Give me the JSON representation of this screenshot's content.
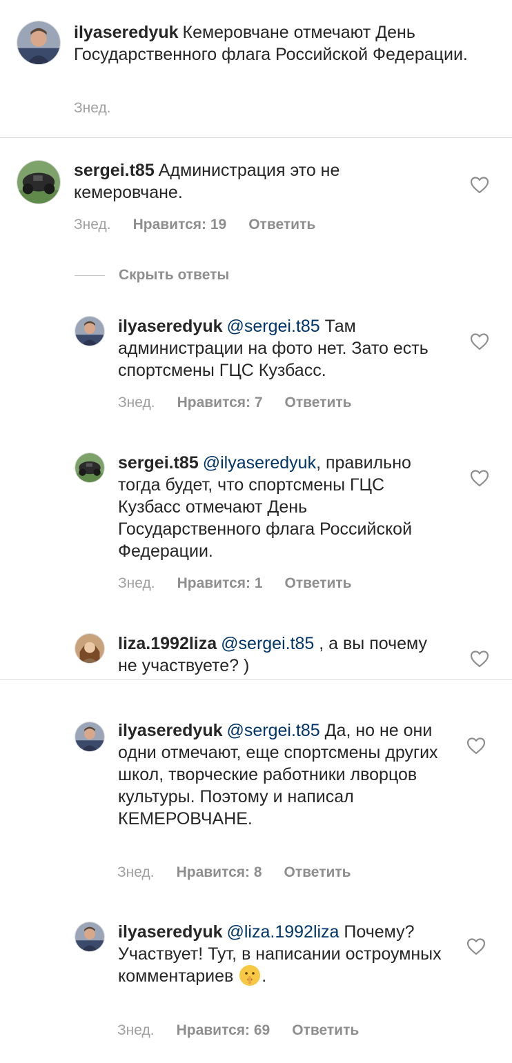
{
  "caption": {
    "username": "ilyaseredyuk",
    "text": "Кемеровчане отмечают День Государственного флага Российской Федерации.",
    "time": "Знед."
  },
  "comments": [
    {
      "username": "sergei.t85",
      "text": "Администрация это не кемеровчане.",
      "time": "Знед.",
      "likes": "Нравится: 19",
      "reply": "Ответить"
    }
  ],
  "hide_replies_label": "Скрыть ответы",
  "replies": [
    {
      "username": "ilyaseredyuk",
      "mention": "@sergei.t85",
      "text": " Там администрации  на фото нет. Зато есть спортсмены ГЦС Кузбасс.",
      "time": "Знед.",
      "likes": "Нравится: 7",
      "reply": "Ответить"
    },
    {
      "username": "sergei.t85",
      "mention": "@ilyaseredyuk",
      "text": ", правильно тогда будет, что спортсмены ГЦС Кузбасс отмечают День Государственного флага Российской Федерации.",
      "time": "Знед.",
      "likes": "Нравится: 1",
      "reply": "Ответить"
    },
    {
      "username": "liza.1992liza",
      "mention": "@sergei.t85",
      "text": " , а вы почему не участвуете? )"
    },
    {
      "username": "ilyaseredyuk",
      "mention": "@sergei.t85",
      "text": " Да, но не они одни отмечают, еще спортсмены других школ, творческие работники лворцов культуры. Поэтому и написал КЕМЕРОВЧАНЕ.",
      "time": "Знед.",
      "likes": "Нравится: 8",
      "reply": "Ответить"
    },
    {
      "username": "ilyaseredyuk",
      "mention": "@liza.1992liza",
      "text": " Почему? Участвует! Тут, в написании остроумных комментариев",
      "text_end": ".",
      "emoji": "shushing-face-emoji",
      "time": "Знед.",
      "likes": "Нравится: 69",
      "reply": "Ответить"
    }
  ],
  "colors": {
    "text": "#262626",
    "mention": "#003569",
    "meta": "#8e8e8e",
    "divider": "#dbdbdb"
  }
}
